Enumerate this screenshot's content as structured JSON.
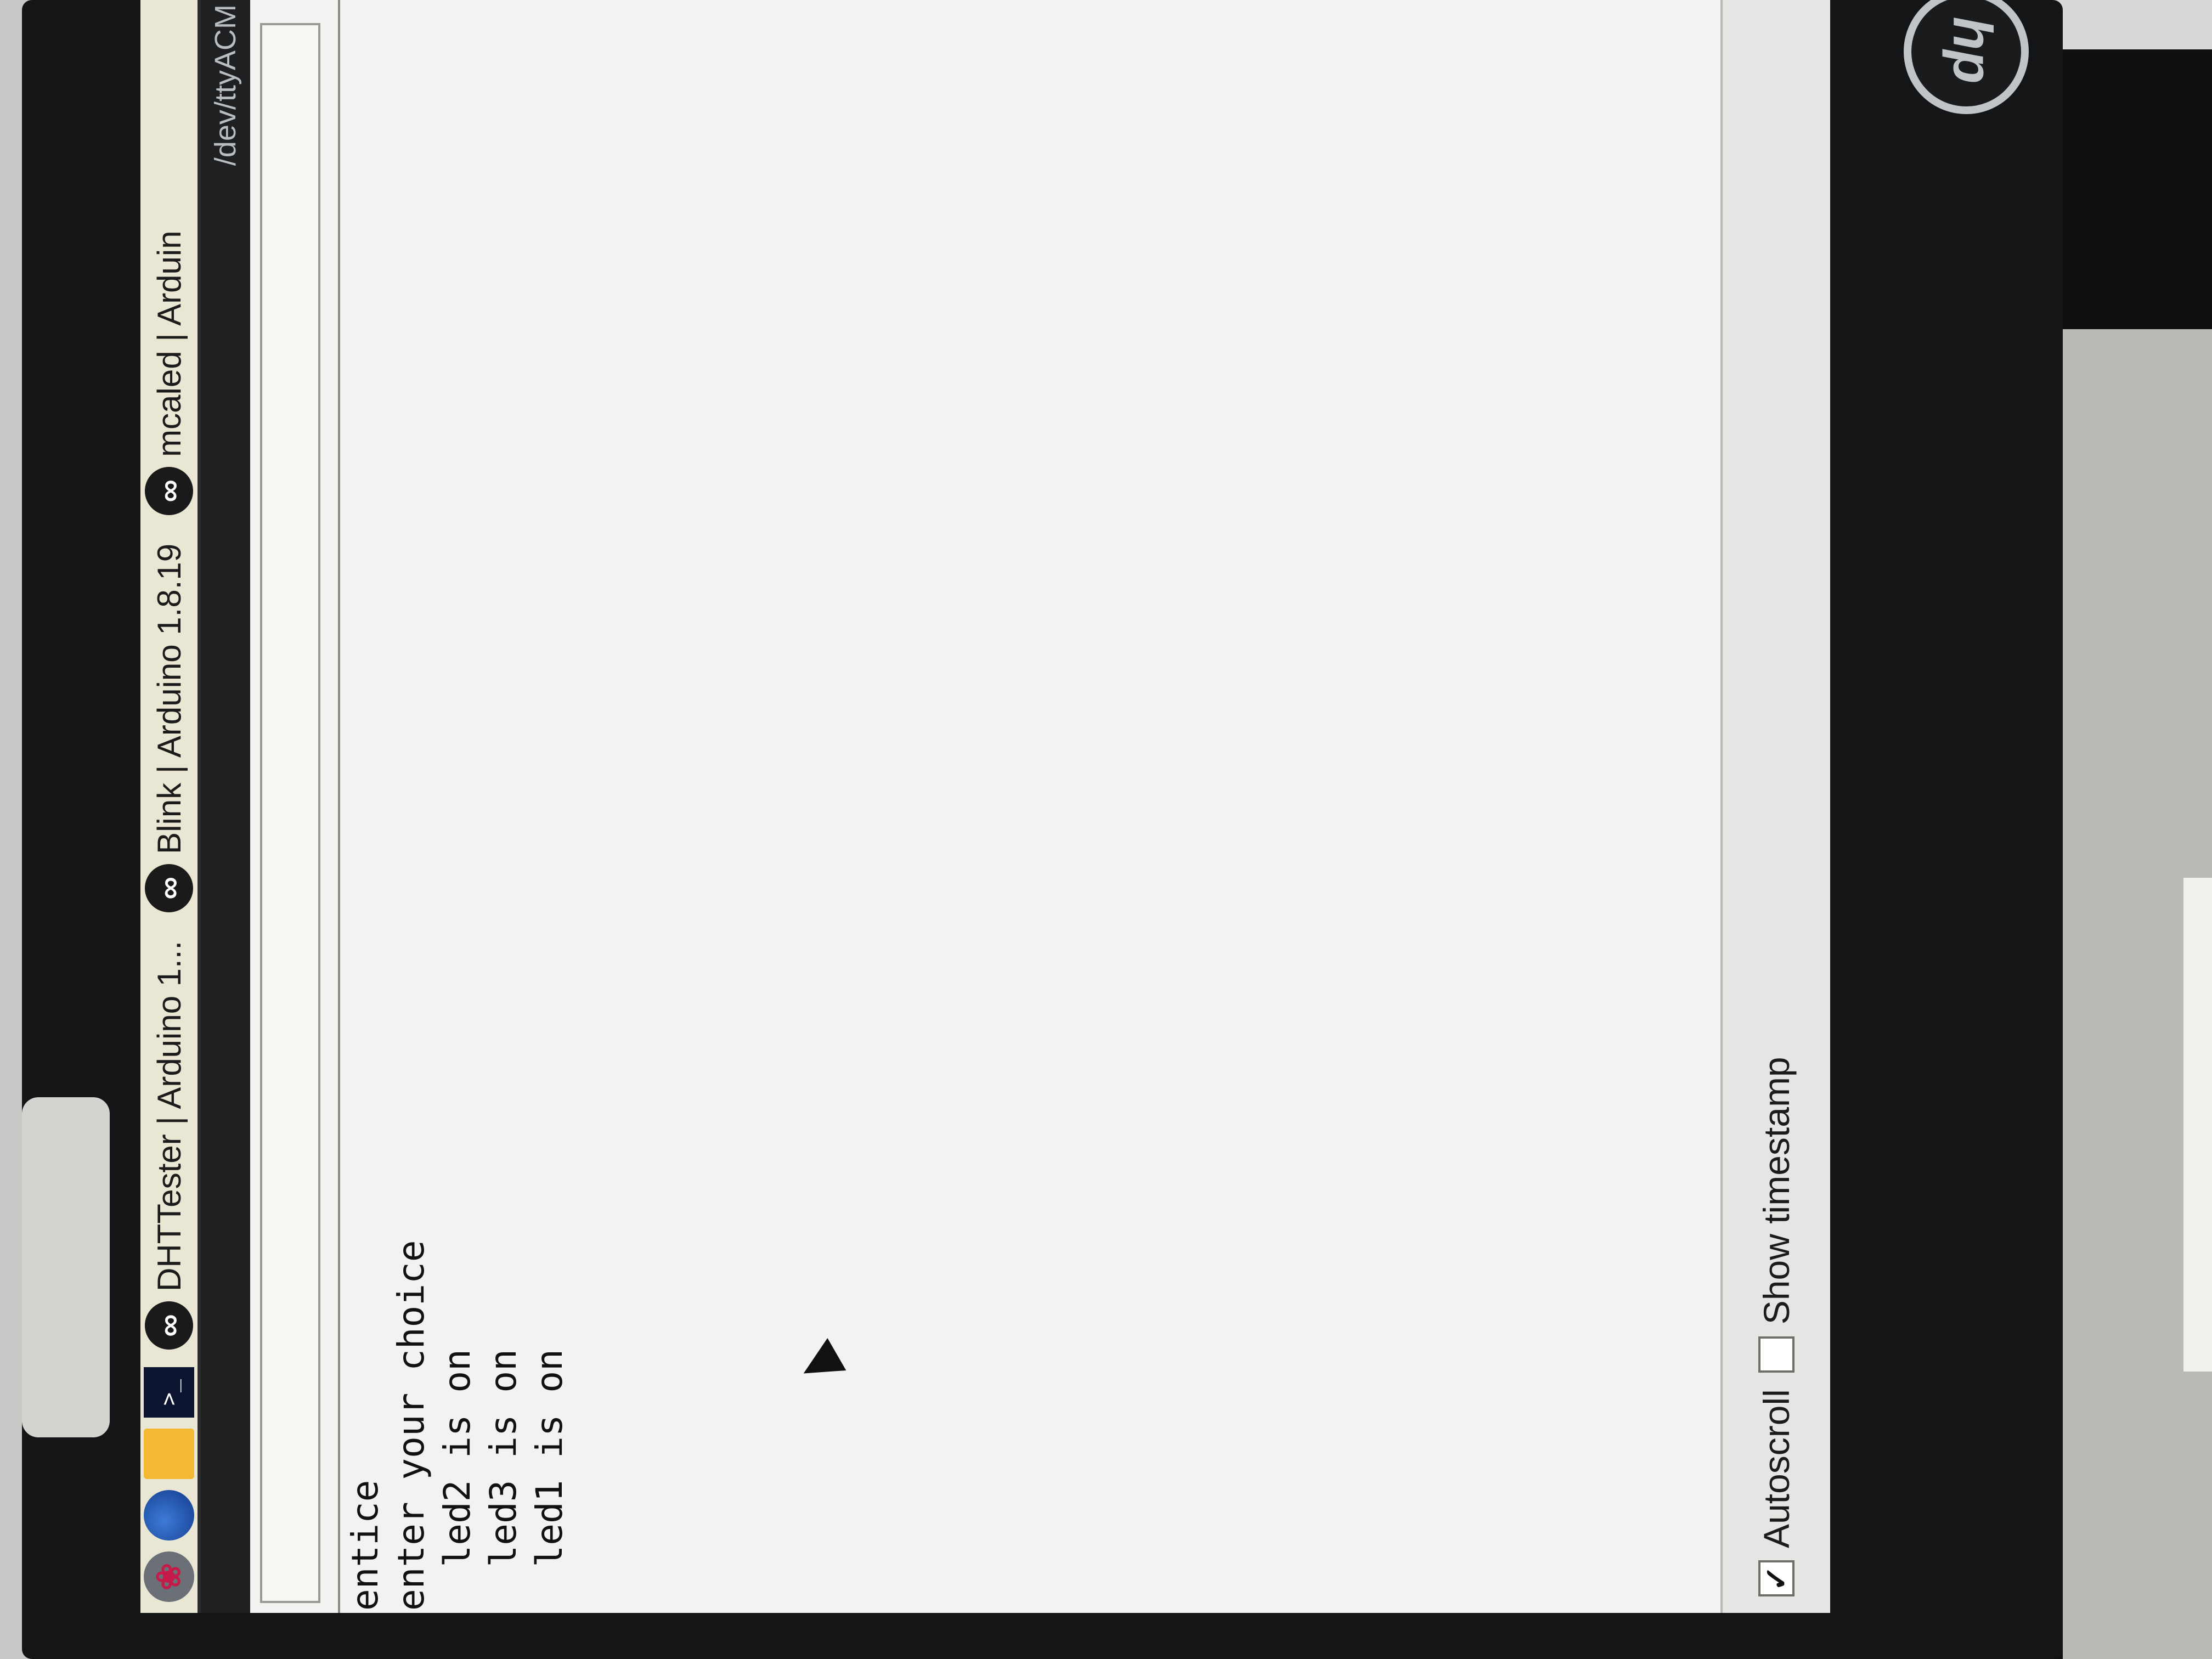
{
  "taskbar": {
    "terminal_glyph": ">_",
    "tasks": [
      {
        "label": "DHTTester | Arduino 1...",
        "icon": "arduino-icon"
      },
      {
        "label": "Blink | Arduino 1.8.19",
        "icon": "arduino-icon"
      },
      {
        "label": "mcaled | Arduin",
        "icon": "arduino-icon"
      }
    ]
  },
  "window": {
    "title": "/dev/ttyACM"
  },
  "serial": {
    "input_value": "",
    "lines": [
      "entice",
      "enter your choice",
      "  led2 is on",
      "  led3 is on",
      "  led1 is on"
    ]
  },
  "options": {
    "autoscroll_label": "Autoscroll",
    "autoscroll_checked": true,
    "timestamp_label": "Show timestamp",
    "timestamp_checked": false
  },
  "monitor_brand": "hp"
}
